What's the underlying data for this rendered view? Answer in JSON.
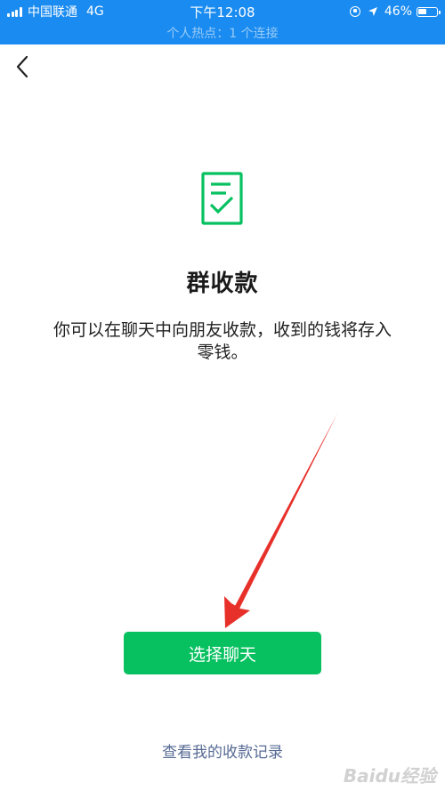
{
  "status_bar": {
    "carrier": "中国联通",
    "network": "4G",
    "time": "下午12:08",
    "battery": "46%",
    "battery_level": 0.46,
    "hotspot": "个人热点：1 个连接",
    "background_color": "#1a8bf0"
  },
  "nav": {
    "back_icon": "chevron-left-icon"
  },
  "main": {
    "icon": "receipt-check-icon",
    "icon_color": "#07c160",
    "title": "群收款",
    "description": "你可以在聊天中向朋友收款，收到的钱将存入零钱。"
  },
  "actions": {
    "primary_label": "选择聊天",
    "primary_color": "#07c160",
    "record_link": "查看我的收款记录",
    "link_color": "#576b95"
  },
  "annotation": {
    "arrow_color": "#e8302a"
  },
  "watermark": {
    "text": "Baidu经验"
  }
}
